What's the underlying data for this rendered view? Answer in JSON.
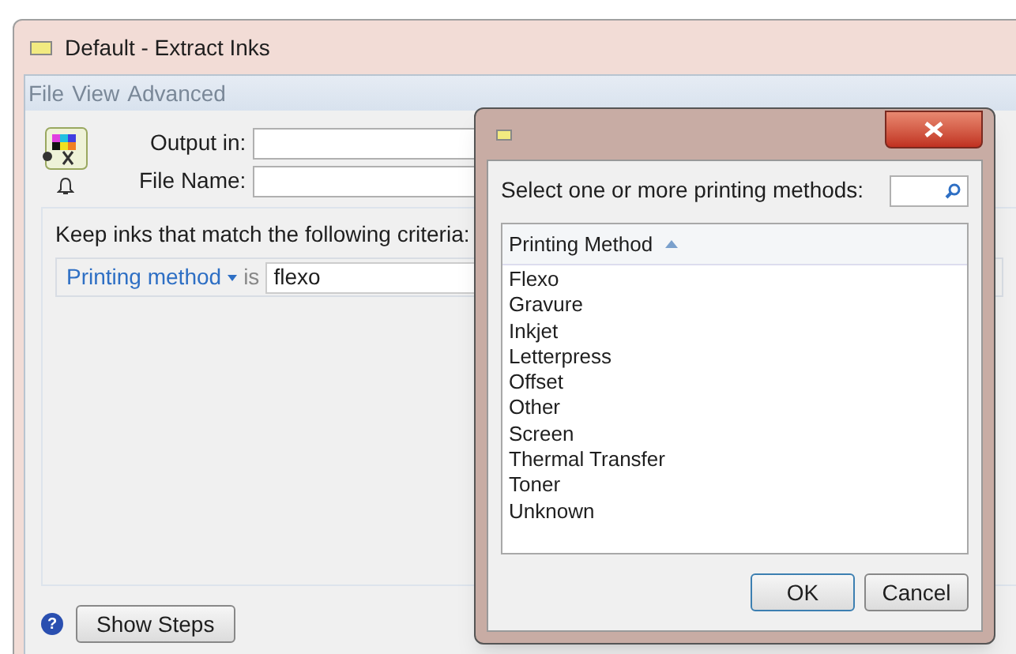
{
  "window": {
    "title": "Default - Extract Inks"
  },
  "menu": [
    "File",
    "View",
    "Advanced"
  ],
  "fields": [
    {
      "label": "Output in:"
    },
    {
      "label": "File Name:"
    }
  ],
  "criteria": {
    "heading": "Keep inks that match the following criteria:",
    "property": "Printing method",
    "operator": "is",
    "value": "flexo"
  },
  "footer": {
    "help": "?",
    "button": "Show Steps"
  },
  "dialog": {
    "prompt": "Select one or more printing methods:",
    "column": "Printing Method",
    "items": [
      {
        "label": "Flexo",
        "selected": false
      },
      {
        "label": "Gravure",
        "selected": false
      },
      {
        "label": "Inkjet",
        "selected": false
      },
      {
        "label": "Letterpress",
        "selected": false
      },
      {
        "label": "Offset",
        "selected": false
      },
      {
        "label": "Other",
        "selected": false
      },
      {
        "label": "Screen",
        "selected": false
      },
      {
        "label": "Thermal Transfer",
        "selected": false
      },
      {
        "label": "Toner",
        "selected": false
      },
      {
        "label": "Unknown",
        "selected": false
      }
    ],
    "buttons": [
      "OK",
      "Cancel"
    ]
  }
}
